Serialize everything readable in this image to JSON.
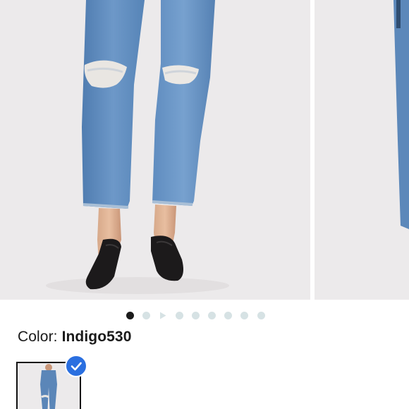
{
  "product": {
    "color_label": "Color: ",
    "color_value": "Indigo530"
  },
  "carousel": {
    "dot_count": 9,
    "active_index": 0,
    "video_index": 2
  },
  "colors": {
    "background": "#eceaeb",
    "denim": "#5b86b8",
    "active_dot": "#1b1b1b",
    "inactive_dot": "#d6e2e4",
    "check_badge": "#2a6fe0"
  },
  "icons": {
    "selected": "checkmark-icon",
    "video": "play-icon"
  }
}
